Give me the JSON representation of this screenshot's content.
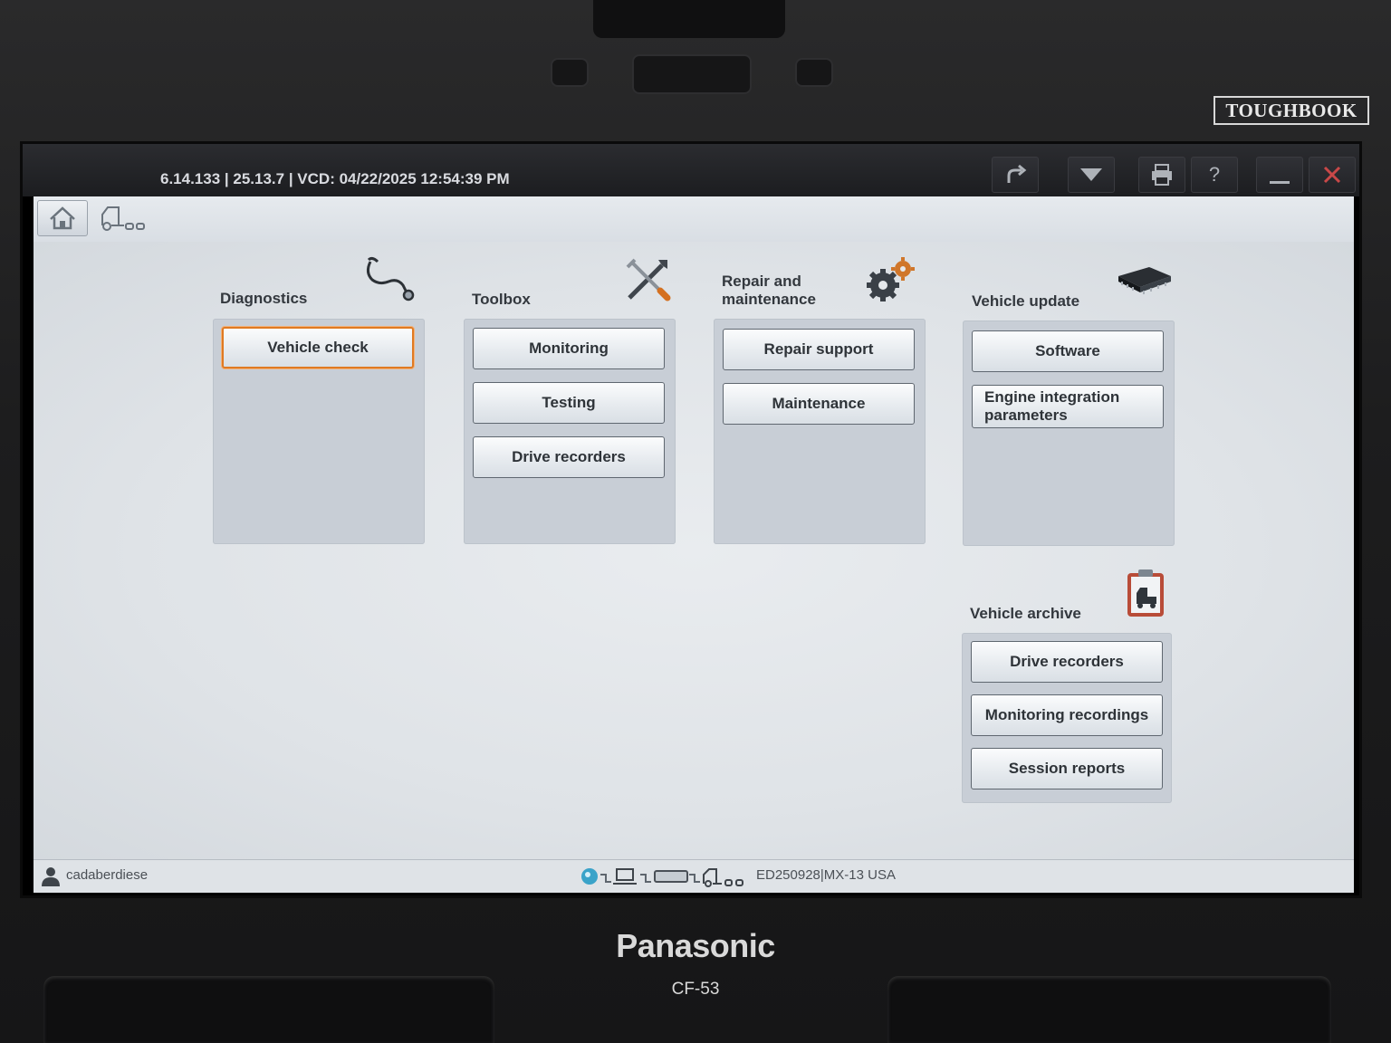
{
  "device": {
    "brand_top": "TOUGHBOOK",
    "brand_bottom": "Panasonic",
    "model": "CF-53"
  },
  "titlebar": {
    "version_info": "6.14.133 | 25.13.7 | VCD: 04/22/2025 12:54:39 PM",
    "buttons": [
      "forward-icon",
      "dropdown-icon",
      "print-icon",
      "help-icon",
      "minimize-icon",
      "close-icon"
    ],
    "help_label": "?"
  },
  "groups": {
    "diagnostics": {
      "title": "Diagnostics",
      "buttons": [
        "Vehicle check"
      ]
    },
    "toolbox": {
      "title": "Toolbox",
      "buttons": [
        "Monitoring",
        "Testing",
        "Drive recorders"
      ]
    },
    "repair": {
      "title": "Repair and maintenance",
      "buttons": [
        "Repair support",
        "Maintenance"
      ]
    },
    "vehicle_update": {
      "title": "Vehicle update",
      "buttons": [
        "Software",
        "Engine integration parameters"
      ]
    },
    "vehicle_archive": {
      "title": "Vehicle archive",
      "buttons": [
        "Drive recorders",
        "Monitoring recordings",
        "Session reports"
      ]
    }
  },
  "statusbar": {
    "user": "cadaberdiese",
    "vehicle": "ED250928|MX-13 USA"
  },
  "colors": {
    "selected_border": "#e07a22",
    "close_icon": "#c94848",
    "panel_bg": "#c8ced6"
  }
}
